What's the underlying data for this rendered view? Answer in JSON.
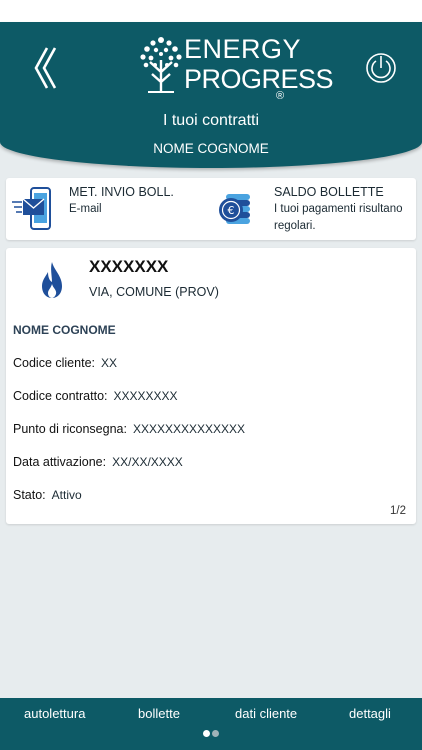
{
  "header": {
    "logo_line1": "ENERGY",
    "logo_line2": "PROGRESS",
    "logo_reg": "®",
    "title": "I tuoi contratti",
    "subtitle": "NOME COGNOME",
    "back_icon": "double-chevron-left-icon",
    "power_icon": "power-icon"
  },
  "info": {
    "send_label": "MET. INVIO BOLL.",
    "send_value": "E-mail",
    "balance_label": "SALDO BOLLETTE",
    "balance_value": "I tuoi pagamenti risultano regolari."
  },
  "contract": {
    "code": "XXXXXXX",
    "address": "VIA, COMUNE (PROV)",
    "holder": "NOME COGNOME",
    "rows": [
      {
        "label": "Codice cliente:",
        "value": "XX"
      },
      {
        "label": "Codice contratto:",
        "value": "XXXXXXXX"
      },
      {
        "label": "Punto di riconsegna:",
        "value": "XXXXXXXXXXXXXX"
      },
      {
        "label": "Data attivazione:",
        "value": "XX/XX/XXXX"
      },
      {
        "label": "Stato:",
        "value": "Attivo"
      }
    ],
    "page": "1/2"
  },
  "nav": {
    "items": [
      "autolettura",
      "bollette",
      "dati cliente",
      "dettagli"
    ],
    "active_page": 1,
    "page_count": 2
  },
  "colors": {
    "primary": "#0d5a66",
    "background": "#e7ecee",
    "icon_blue": "#1f4f9a"
  }
}
